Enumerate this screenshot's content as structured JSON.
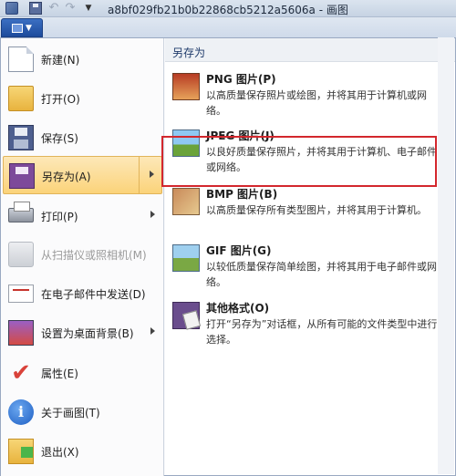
{
  "titlebar": {
    "title": "a8bf029fb21b0b22868cb5212a5606a - 画图",
    "icons": [
      "paint-app-icon",
      "save-icon",
      "undo-icon",
      "redo-icon",
      "customize-quick-access-icon"
    ]
  },
  "app_button": {
    "icon": "application-menu-icon"
  },
  "left_menu": [
    {
      "label": "新建(N)",
      "icon": "new-document-icon"
    },
    {
      "label": "打开(O)",
      "icon": "open-folder-icon"
    },
    {
      "label": "保存(S)",
      "icon": "save-icon"
    },
    {
      "label": "另存为(A)",
      "icon": "save-as-icon"
    },
    {
      "label": "打印(P)",
      "icon": "printer-icon"
    },
    {
      "label": "从扫描仪或照相机(M)",
      "icon": "scanner-icon"
    },
    {
      "label": "在电子邮件中发送(D)",
      "icon": "email-icon"
    },
    {
      "label": "设置为桌面背景(B)",
      "icon": "desktop-background-icon"
    },
    {
      "label": "属性(E)",
      "icon": "checkmark-icon"
    },
    {
      "label": "关于画图(T)",
      "icon": "info-icon"
    },
    {
      "label": "退出(X)",
      "icon": "exit-icon"
    }
  ],
  "right_panel": {
    "header": "另存为",
    "items": [
      {
        "title": "PNG 图片(P)",
        "desc": "以高质量保存照片或绘图，并将其用于计算机或网络。",
        "icon": "png-image-icon"
      },
      {
        "title": "JPEG 图片(J)",
        "desc": "以良好质量保存照片，并将其用于计算机、电子邮件或网络。",
        "icon": "jpeg-image-icon"
      },
      {
        "title": "BMP 图片(B)",
        "desc": "以高质量保存所有类型图片，并将其用于计算机。",
        "icon": "bmp-image-icon"
      },
      {
        "title": "GIF 图片(G)",
        "desc": "以较低质量保存简单绘图，并将其用于电子邮件或网络。",
        "icon": "gif-image-icon"
      },
      {
        "title": "其他格式(O)",
        "desc": "打开“另存为”对话框，从所有可能的文件类型中进行选择。",
        "icon": "other-formats-icon"
      }
    ]
  },
  "colors": {
    "highlight_border": "#d3272d",
    "active_item": "#fbd37a"
  }
}
